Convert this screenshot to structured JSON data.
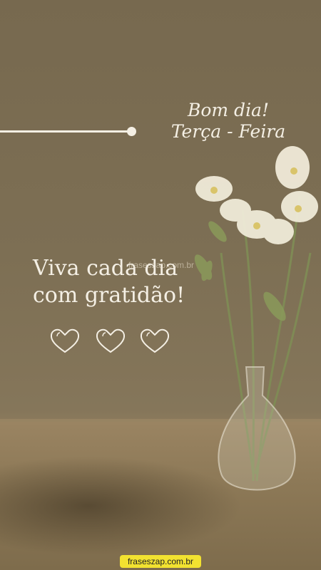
{
  "greeting": {
    "line1": "Bom dia!",
    "line2": "Terça - Feira"
  },
  "quote": {
    "line1": "Viva cada dia",
    "line2": "com gratidão!"
  },
  "watermark": "fraseszap.com.br",
  "footer_badge": "fraseszap.com.br",
  "hearts": [
    "heart-icon",
    "heart-icon",
    "heart-icon"
  ],
  "colors": {
    "text": "#f4efe4",
    "background": "#7d6f54",
    "badge": "#f2e230"
  }
}
